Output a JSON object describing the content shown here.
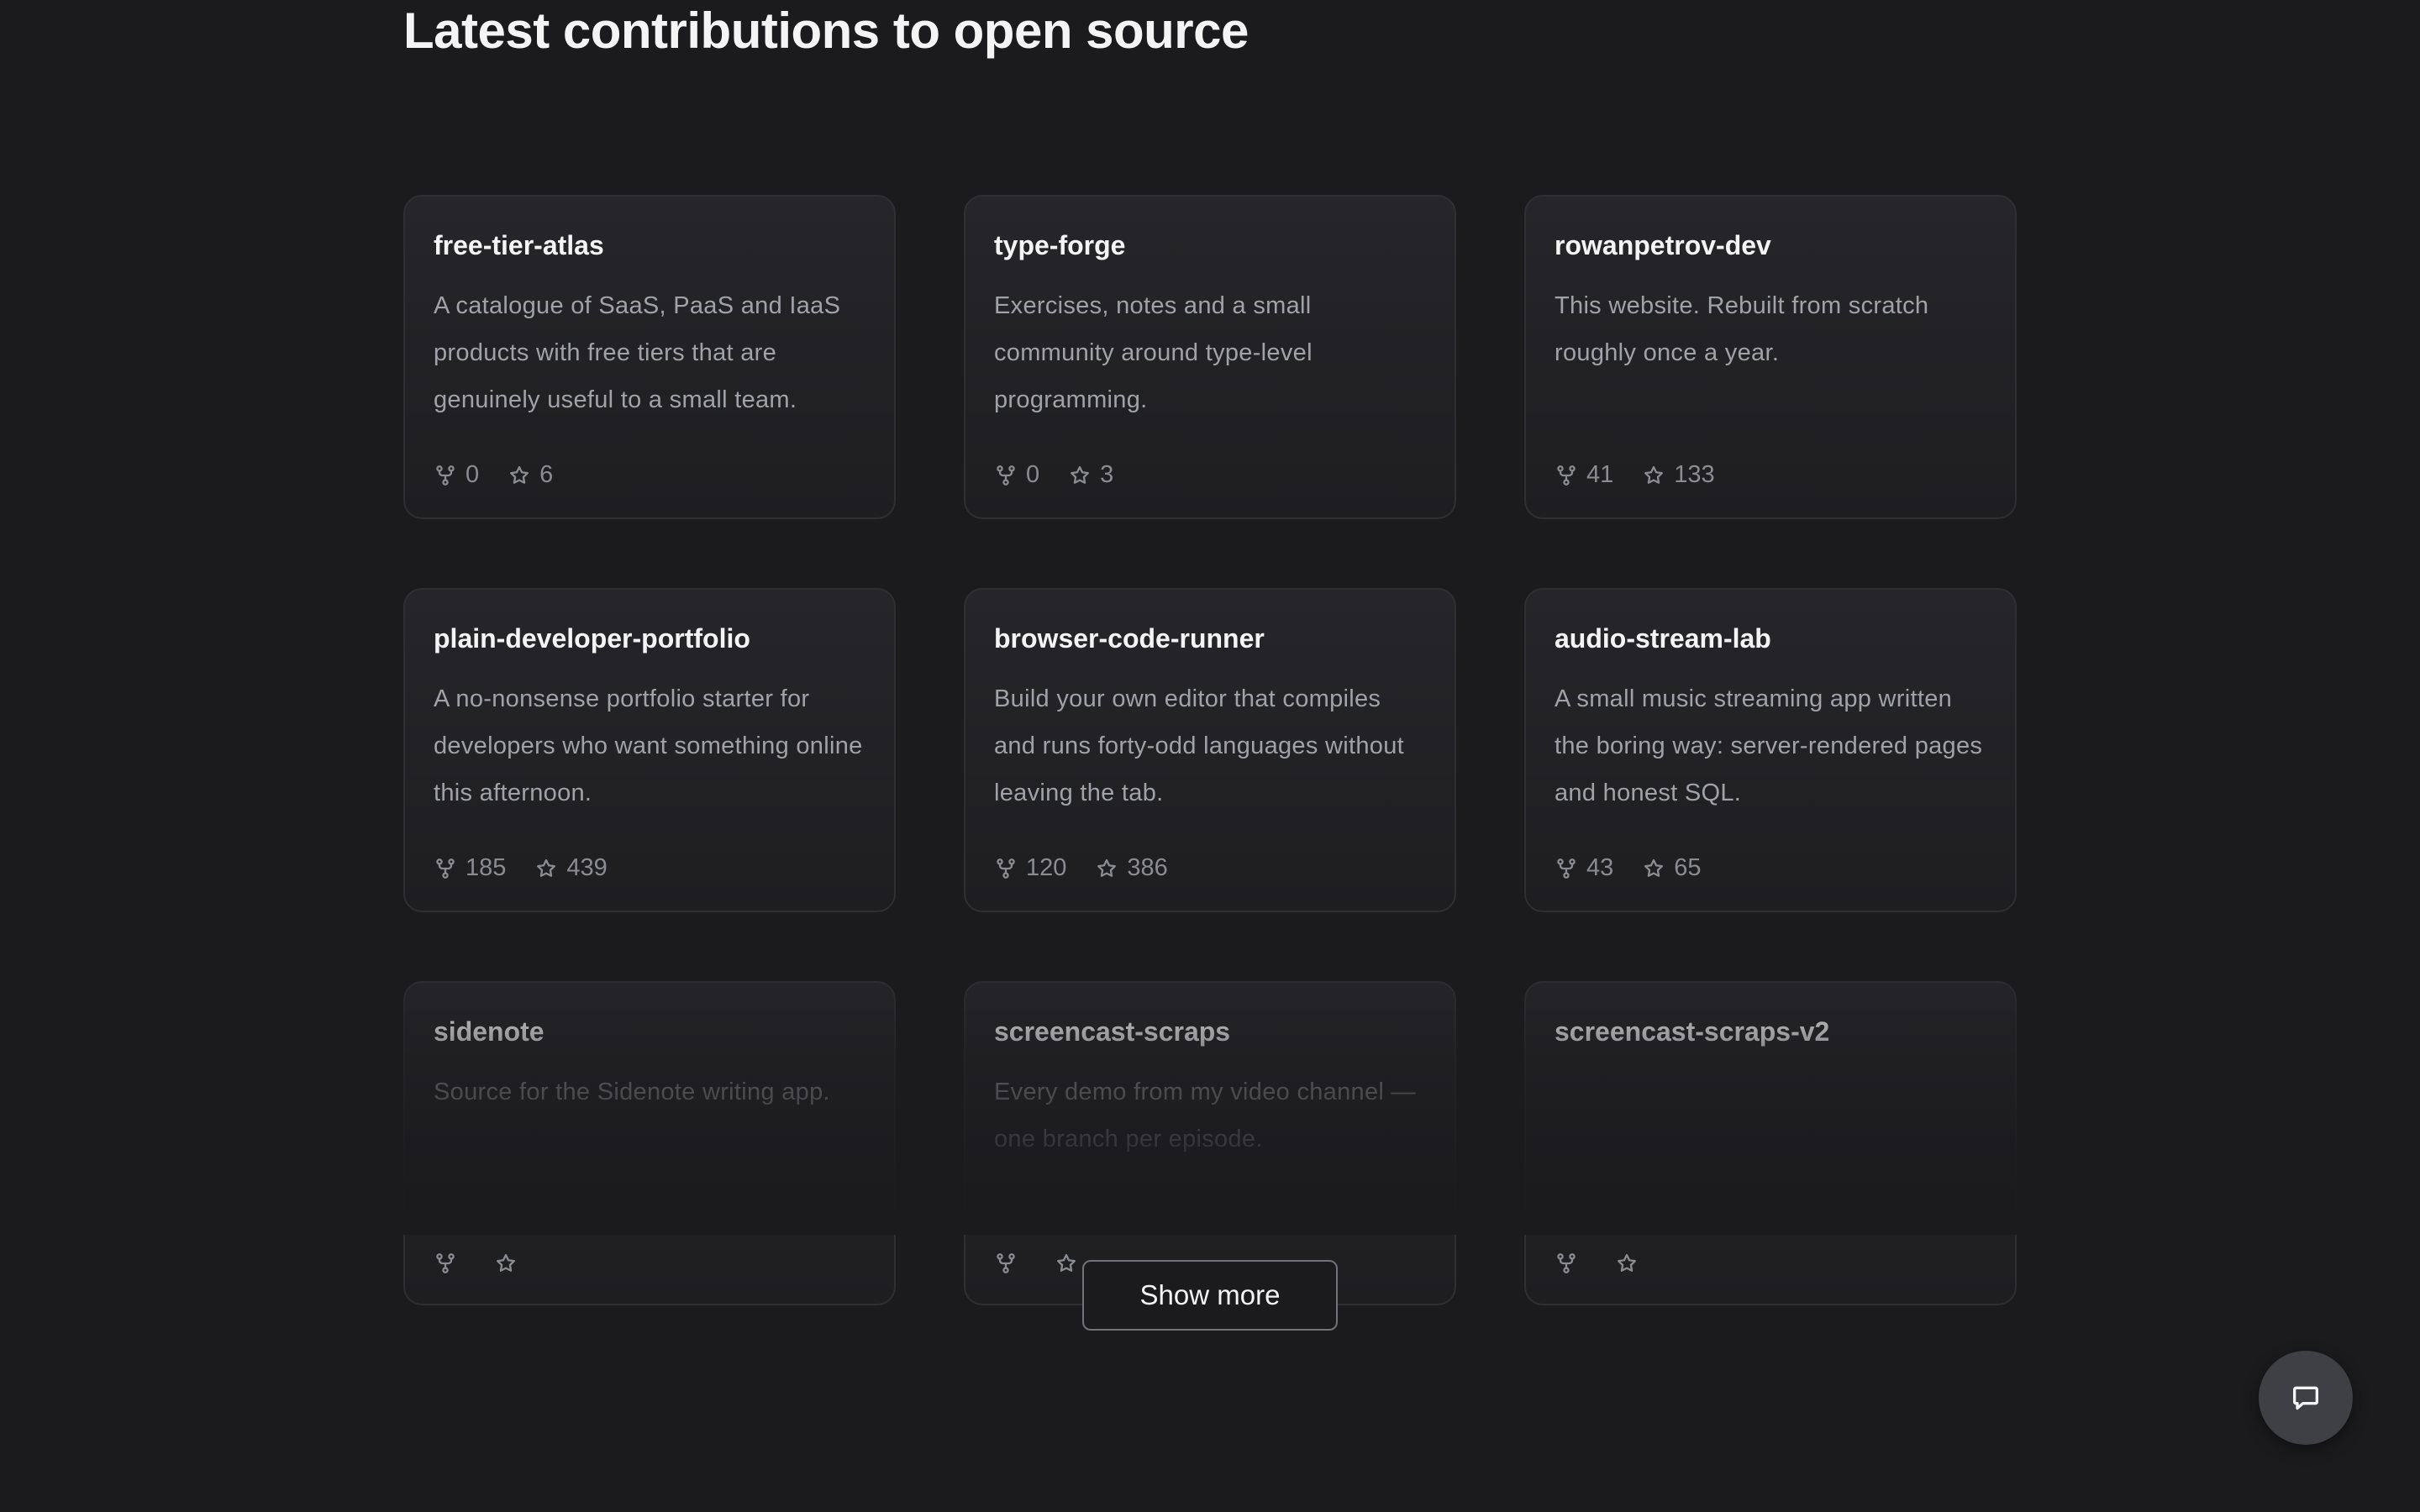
{
  "section": {
    "title": "Latest contributions to open source"
  },
  "repos": [
    {
      "name": "free-tier-atlas",
      "description": "A catalogue of SaaS, PaaS and IaaS products with free tiers that are genuinely useful to a small team.",
      "forks": "0",
      "stars": "6"
    },
    {
      "name": "type-forge",
      "description": "Exercises, notes and a small community around type-level programming.",
      "forks": "0",
      "stars": "3"
    },
    {
      "name": "rowanpetrov-dev",
      "description": "This website. Rebuilt from scratch roughly once a year.",
      "forks": "41",
      "stars": "133"
    },
    {
      "name": "plain-developer-portfolio",
      "description": "A no-nonsense portfolio starter for developers who want something online this afternoon.",
      "forks": "185",
      "stars": "439"
    },
    {
      "name": "browser-code-runner",
      "description": "Build your own editor that compiles and runs forty-odd languages without leaving the tab.",
      "forks": "120",
      "stars": "386"
    },
    {
      "name": "audio-stream-lab",
      "description": "A small music streaming app written the boring way: server-rendered pages and honest SQL.",
      "forks": "43",
      "stars": "65"
    },
    {
      "name": "sidenote",
      "description": "Source for the Sidenote writing app.",
      "forks": "",
      "stars": ""
    },
    {
      "name": "screencast-scraps",
      "description": "Every demo from my video channel — one branch per episode.",
      "forks": "",
      "stars": ""
    },
    {
      "name": "screencast-scraps-v2",
      "description": "",
      "forks": "",
      "stars": ""
    }
  ],
  "actions": {
    "show_more_label": "Show more"
  },
  "icons": {
    "fork": "fork-icon",
    "star": "star-icon",
    "chat": "chat-bubble-icon"
  },
  "colors": {
    "background": "#1b1b1e",
    "card_border": "#2e2e33",
    "text_primary": "#f4f4f5",
    "text_secondary": "#a1a1aa"
  }
}
